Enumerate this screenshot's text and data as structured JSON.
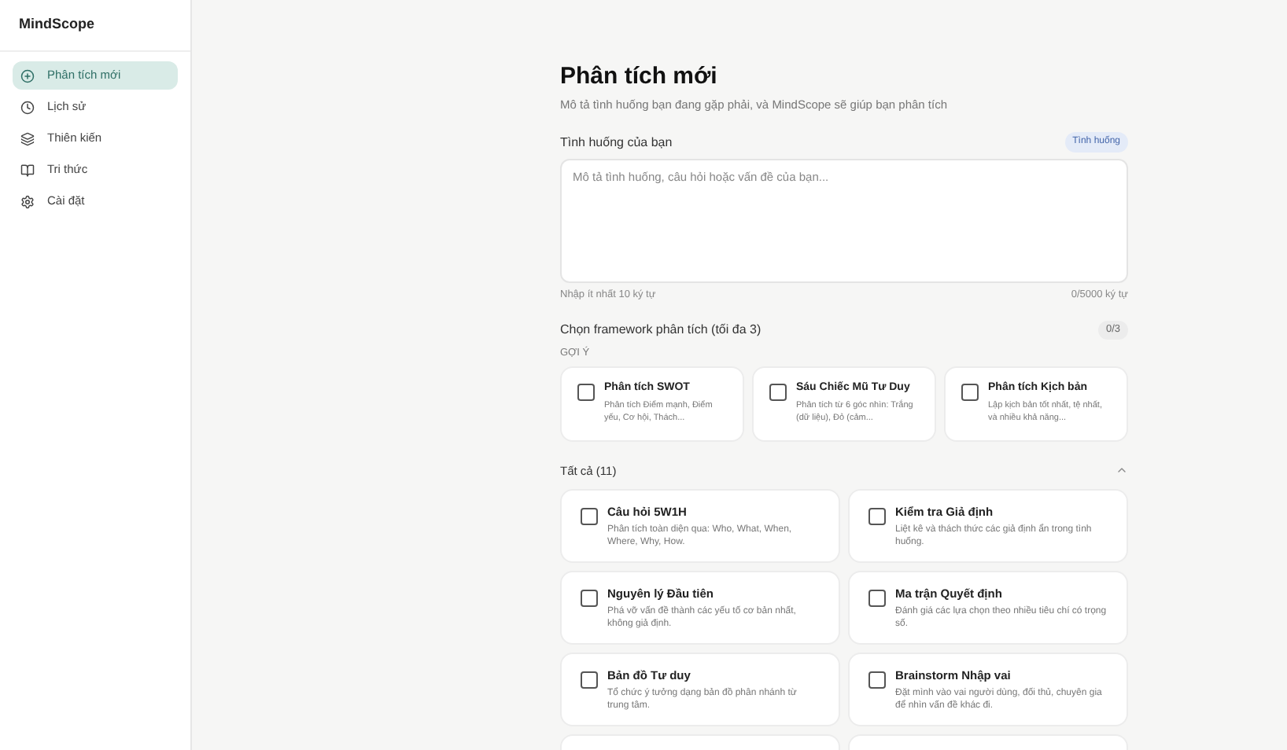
{
  "sidebar": {
    "brand": "MindScope",
    "items": [
      {
        "label": "Phân tích mới",
        "selected": true
      },
      {
        "label": "Lịch sử",
        "selected": false
      },
      {
        "label": "Thiên kiến",
        "selected": false
      },
      {
        "label": "Tri thức",
        "selected": false
      },
      {
        "label": "Cài đặt",
        "selected": false
      }
    ]
  },
  "page": {
    "title": "Phân tích mới",
    "subtitle": "Mô tả tình huống bạn đang gặp phải, và MindScope sẽ giúp bạn phân tích"
  },
  "situation": {
    "label": "Tình huống của bạn",
    "badge": "Tình huống",
    "placeholder": "Mô tả tình huống, câu hỏi hoặc vấn đề của bạn...",
    "hint": "Nhập ít nhất 10 ký tự",
    "counter": "0/5000 ký tự"
  },
  "framework": {
    "label": "Chọn framework phân tích (tối đa 3)",
    "counter": "0/3",
    "suggest_label": "GỢI Ý",
    "suggestions": [
      {
        "title": "Phân tích SWOT",
        "desc": "Phân tích Điểm mạnh, Điểm yếu, Cơ hội, Thách...",
        "checked": false
      },
      {
        "title": "Sáu Chiếc Mũ Tư Duy",
        "desc": "Phân tích từ 6 góc nhìn: Trắng (dữ liệu), Đỏ (cảm...",
        "checked": false
      },
      {
        "title": "Phân tích Kịch bản",
        "desc": "Lập kịch bản tốt nhất, tệ nhất, và nhiều khả năng...",
        "checked": false
      }
    ],
    "all_label": "Tất cả (11)",
    "expanded": true,
    "all": [
      {
        "title": "Câu hỏi 5W1H",
        "desc": "Phân tích toàn diện qua: Who, What, When, Where, Why, How.",
        "checked": false
      },
      {
        "title": "Kiểm tra Giả định",
        "desc": "Liệt kê và thách thức các giả định ẩn trong tình huống.",
        "checked": false
      },
      {
        "title": "Nguyên lý Đầu tiên",
        "desc": "Phá vỡ vấn đề thành các yếu tố cơ bản nhất, không giả định.",
        "checked": false
      },
      {
        "title": "Ma trận Quyết định",
        "desc": "Đánh giá các lựa chọn theo nhiều tiêu chí có trọng số.",
        "checked": false
      },
      {
        "title": "Bản đồ Tư duy",
        "desc": "Tổ chức ý tưởng dạng bản đồ phân nhánh từ trung tâm.",
        "checked": false
      },
      {
        "title": "Brainstorm Nhập vai",
        "desc": "Đặt mình vào vai người dùng, đối thủ, chuyên gia để nhìn vấn đề khác đi.",
        "checked": false
      }
    ]
  }
}
